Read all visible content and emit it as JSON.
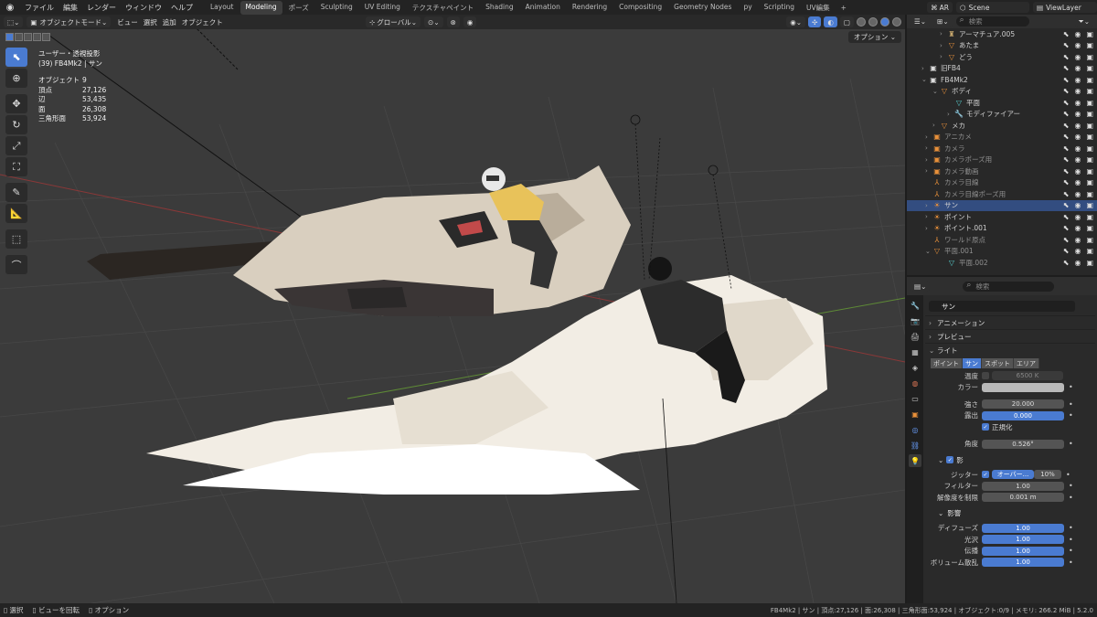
{
  "app": {
    "menu": [
      "ファイル",
      "編集",
      "レンダー",
      "ウィンドウ",
      "ヘルプ"
    ],
    "workspaces": [
      "Layout",
      "Modeling",
      "ポーズ",
      "Sculpting",
      "UV Editing",
      "テクスチャペイント",
      "Shading",
      "Animation",
      "Rendering",
      "Compositing",
      "Geometry Nodes",
      "py",
      "Scripting",
      "UV編集"
    ],
    "active_workspace": "Modeling",
    "ar_label": "AR",
    "scene": "Scene",
    "view_layer": "ViewLayer"
  },
  "viewport": {
    "mode": "オブジェクトモード",
    "menus": [
      "ビュー",
      "選択",
      "追加",
      "オブジェクト"
    ],
    "orientation": "グローバル",
    "options": "オプション",
    "view_name": "ユーザー・透視投影",
    "context": "(39) FB4Mk2 | サン",
    "stats": [
      {
        "label": "オブジェクト",
        "value": "9"
      },
      {
        "label": "頂点",
        "value": "27,126"
      },
      {
        "label": "辺",
        "value": "53,435"
      },
      {
        "label": "面",
        "value": "26,308"
      },
      {
        "label": "三角形面",
        "value": "53,924"
      }
    ]
  },
  "outliner": {
    "search_placeholder": "検索",
    "rows": [
      {
        "label": "アーマチュア.005",
        "ico": "♜",
        "color": "#c9a96e",
        "indent": 36,
        "arrow": "›"
      },
      {
        "label": "あたま",
        "ico": "▽",
        "color": "#e8903a",
        "indent": 36,
        "arrow": "›"
      },
      {
        "label": "どう",
        "ico": "▽",
        "color": "#e8903a",
        "indent": 36,
        "arrow": "›"
      },
      {
        "label": "旧FB4",
        "ico": "▣",
        "color": "#ddd",
        "indent": 16,
        "arrow": "›"
      },
      {
        "label": "FB4Mk2",
        "ico": "▣",
        "color": "#ddd",
        "indent": 16,
        "arrow": "⌄"
      },
      {
        "label": "ボディ",
        "ico": "▽",
        "color": "#e8903a",
        "indent": 28,
        "arrow": "⌄"
      },
      {
        "label": "平面",
        "ico": "▽",
        "color": "#5cc",
        "indent": 44,
        "arrow": ""
      },
      {
        "label": "モディファイアー",
        "ico": "🔧",
        "color": "#6aa0ff",
        "indent": 44,
        "arrow": "›"
      },
      {
        "label": "メカ",
        "ico": "▽",
        "color": "#e8903a",
        "indent": 28,
        "arrow": "›"
      },
      {
        "label": "アニカメ",
        "ico": "▣",
        "color": "#e8903a",
        "indent": 20,
        "arrow": "›",
        "dim": true
      },
      {
        "label": "カメラ",
        "ico": "▣",
        "color": "#e8903a",
        "indent": 20,
        "arrow": "›",
        "dim": true
      },
      {
        "label": "カメラポーズ用",
        "ico": "▣",
        "color": "#e8903a",
        "indent": 20,
        "arrow": "›",
        "dim": true
      },
      {
        "label": "カメラ動画",
        "ico": "▣",
        "color": "#e8903a",
        "indent": 20,
        "arrow": "›",
        "dim": true
      },
      {
        "label": "カメラ目線",
        "ico": "⅄",
        "color": "#e8903a",
        "indent": 20,
        "arrow": "",
        "dim": true
      },
      {
        "label": "カメラ目線ポーズ用",
        "ico": "⅄",
        "color": "#e8903a",
        "indent": 20,
        "arrow": "",
        "dim": true
      },
      {
        "label": "サン",
        "ico": "☀",
        "color": "#e8903a",
        "indent": 20,
        "arrow": "›",
        "sel": true
      },
      {
        "label": "ポイント",
        "ico": "☀",
        "color": "#e8903a",
        "indent": 20,
        "arrow": "›"
      },
      {
        "label": "ポイント.001",
        "ico": "☀",
        "color": "#e8903a",
        "indent": 20,
        "arrow": "›"
      },
      {
        "label": "ワールド原点",
        "ico": "⅄",
        "color": "#e8903a",
        "indent": 20,
        "arrow": "",
        "dim": true
      },
      {
        "label": "平面.001",
        "ico": "▽",
        "color": "#e8903a",
        "indent": 20,
        "arrow": "⌄",
        "dim": true
      },
      {
        "label": "平面.002",
        "ico": "▽",
        "color": "#5cc",
        "indent": 36,
        "arrow": "",
        "dim": true
      }
    ]
  },
  "properties": {
    "search_placeholder": "検索",
    "object_name": "サン",
    "panels": {
      "animation": "アニメーション",
      "preview": "プレビュー",
      "light": "ライト"
    },
    "light_types": [
      "ポイント",
      "サン",
      "スポット",
      "エリア"
    ],
    "active_light_type": "サン",
    "temperature_label": "温度",
    "temperature_value": "6500 K",
    "color_label": "カラー",
    "strength_label": "強さ",
    "strength_value": "20.000",
    "exposure_label": "露出",
    "exposure_value": "0.000",
    "normalize_label": "正規化",
    "angle_label": "角度",
    "angle_value": "0.526°",
    "shadow_label": "影",
    "jitter_label": "ジッター",
    "jitter_value": "オーバー...",
    "jitter_pct": "10%",
    "filter_label": "フィルター",
    "filter_value": "1.00",
    "res_limit_label": "解像度を制限",
    "res_limit_value": "0.001 m",
    "influence_label": "影響",
    "influence": [
      {
        "label": "ディフューズ",
        "value": "1.00"
      },
      {
        "label": "光沢",
        "value": "1.00"
      },
      {
        "label": "伝播",
        "value": "1.00"
      },
      {
        "label": "ボリューム散乱",
        "value": "1.00"
      }
    ]
  },
  "status": {
    "select": "選択",
    "rotate": "ビューを回転",
    "options": "オプション",
    "right": "FB4Mk2 | サン | 頂点:27,126 | 面:26,308 | 三角形面:53,924 | オブジェクト:0/9 | メモリ: 266.2 MiB | 5.2.0"
  }
}
